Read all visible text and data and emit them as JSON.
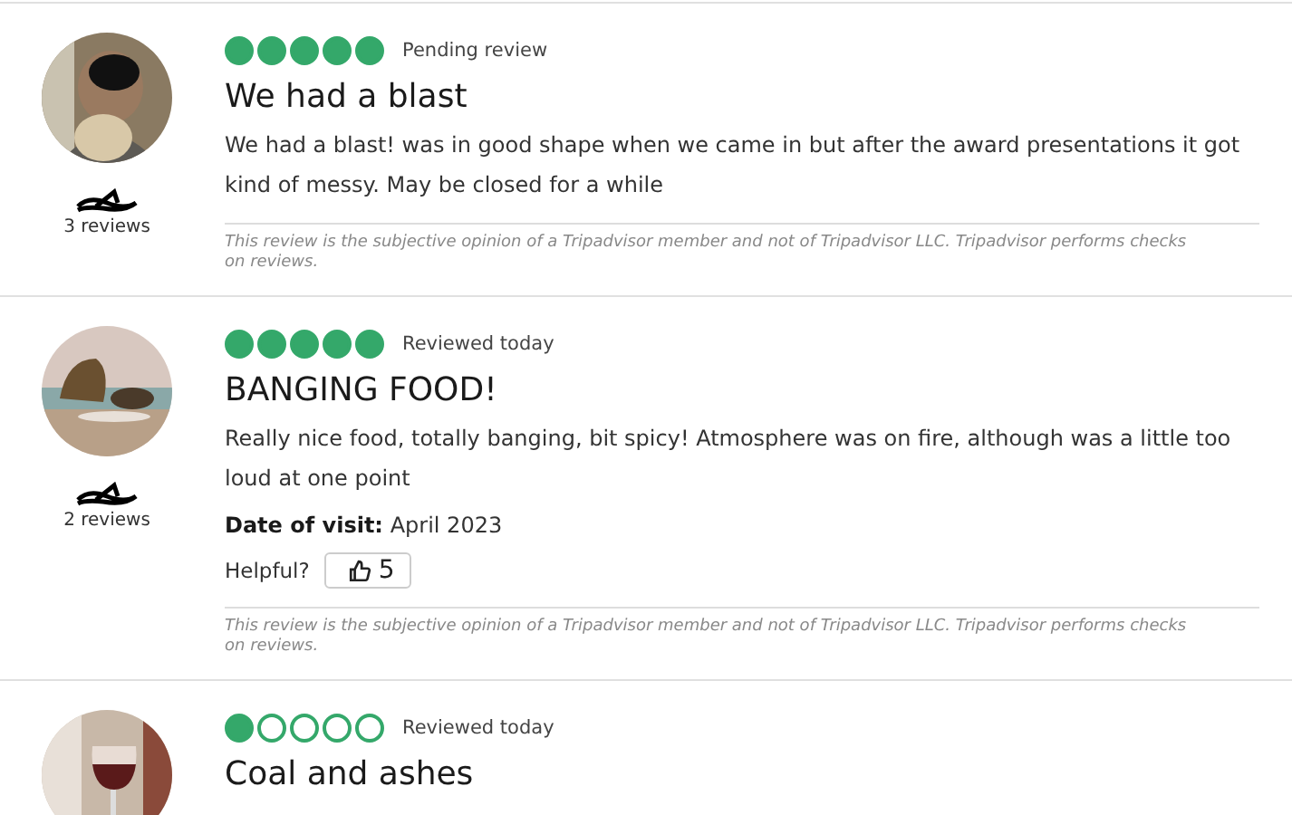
{
  "reviews": [
    {
      "review_count": "3 reviews",
      "stars": 5,
      "status": "Pending review",
      "title": "We had a blast",
      "body": "We had a blast! was in good shape when we came in but after the award presentations it got kind of messy. May be closed for a while",
      "disclaimer": "This review is the subjective opinion of a Tripadvisor member and not of Tripadvisor LLC. Tripadvisor performs checks on reviews."
    },
    {
      "review_count": "2 reviews",
      "stars": 5,
      "status": "Reviewed today",
      "title": "BANGING FOOD!",
      "body": "Really nice food, totally banging, bit spicy! Atmosphere was on fire, although was a little too loud at one point",
      "date_label": "Date of visit:",
      "date": "April 2023",
      "helpful_label": "Helpful?",
      "helpful_count": "5",
      "disclaimer": "This review is the subjective opinion of a Tripadvisor member and not of Tripadvisor LLC. Tripadvisor performs checks on reviews."
    },
    {
      "stars": 1,
      "status": "Reviewed today",
      "title": "Coal and ashes"
    }
  ]
}
